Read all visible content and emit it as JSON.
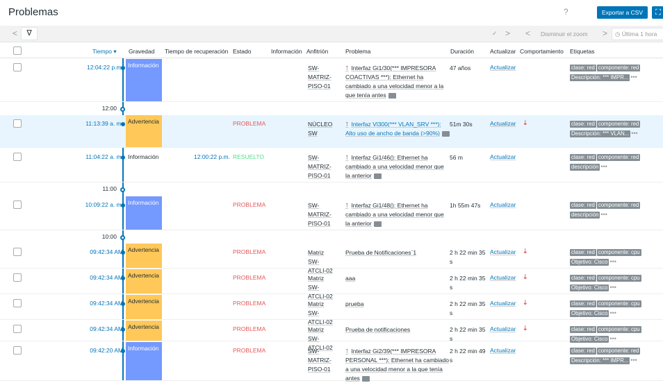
{
  "header": {
    "title": "Problemas",
    "help": "?",
    "export_label": "Exportar a CSV",
    "kiosk": "⛶"
  },
  "filterbar": {
    "prev": "<",
    "funnel": "∇",
    "chevron": "✓",
    "next": ">",
    "prev2": "<",
    "zoom_out": "Disminuir el zoom",
    "next2": ">",
    "time_range": "Última 1 hora"
  },
  "columns": {
    "time": "Tiempo ▾",
    "severity": "Gravedad",
    "recovery": "Tiempo de recuperación",
    "status": "Estado",
    "info": "Información",
    "host": "Anfitrión",
    "problem": "Problema",
    "duration": "Duración",
    "update": "Actualizar",
    "behavior": "Comportamiento",
    "tags": "Etiquetas"
  },
  "separators": [
    "12:00",
    "11:00",
    "10:00"
  ],
  "rows": [
    {
      "time": "12:04:22 p.m.",
      "severity": "Información",
      "recovery": "",
      "status": "",
      "host": "SW-MATRIZ-PISO-01",
      "problem": "Interfaz Gi1/30(*** IMPRESORA COACTIVAS ***): Ethernet ha cambiado a una velocidad menor a la que tenía antes",
      "duration": "47 años",
      "update": "Actualizar",
      "tags": [
        "clase: red",
        "componente: red",
        "Descripción: *** IMPR..."
      ]
    },
    {
      "time": "11:13:39 a. m.",
      "severity": "Advertencia",
      "recovery": "",
      "status": "PROBLEMA",
      "host": "NÚCLEO SW",
      "problem": "Interfaz Vl300(*** VLAN_SRV ***): Alto uso de ancho de banda (>90%)",
      "duration": "51m 30s",
      "update": "Actualizar",
      "tags": [
        "clase: red",
        "componente: red",
        "Descripción: *** VLAN..."
      ]
    },
    {
      "time": "11:04:22 a. m.",
      "severity": "Información",
      "recovery": "12:00:22 p.m.",
      "status": "RESUELTO",
      "host": "SW-MATRIZ-PISO-01",
      "problem": "Interfaz Gi1/46(): Ethernet ha cambiado a una velocidad menor que la anterior",
      "duration": "56 m",
      "update": "Actualizar",
      "tags": [
        "clase: red",
        "componente: red",
        "descripción"
      ]
    },
    {
      "time": "10:09:22 a. m.",
      "severity": "Información",
      "recovery": "",
      "status": "PROBLEMA",
      "host": "SW-MATRIZ-PISO-01",
      "problem": "Interfaz Gi1/48(): Ethernet ha cambiado a una velocidad menor que la anterior",
      "duration": "1h 55m 47s",
      "update": "Actualizar",
      "tags": [
        "clase: red",
        "componente: red",
        "descripción"
      ]
    },
    {
      "time": "09:42:34 AM",
      "severity": "Advertencia",
      "recovery": "",
      "status": "PROBLEMA",
      "host": "Matriz SW-ATCLI-02",
      "problem": "Prueba de Notificaciones`1",
      "duration": "2 h 22 min 35 s",
      "update": "Actualizar",
      "tags": [
        "clase: red",
        "componente: cpu",
        "Objetivo: Cisco"
      ]
    },
    {
      "time": "09:42:34 AM",
      "severity": "Advertencia",
      "recovery": "",
      "status": "PROBLEMA",
      "host": "Matriz SW-ATCLI-02",
      "problem": "aaa",
      "duration": "2 h 22 min 35 s",
      "update": "Actualizar",
      "tags": [
        "clase: red",
        "componente: cpu",
        "Objetivo: Cisco"
      ]
    },
    {
      "time": "09:42:34 AM",
      "severity": "Advertencia",
      "recovery": "",
      "status": "PROBLEMA",
      "host": "Matriz SW-ATCLI-02",
      "problem": "prueba",
      "duration": "2 h 22 min 35 s",
      "update": "Actualizar",
      "tags": [
        "clase: red",
        "componente: cpu",
        "Objetivo: Cisco"
      ]
    },
    {
      "time": "09:42:34 AM",
      "severity": "Advertencia",
      "recovery": "",
      "status": "PROBLEMA",
      "host": "Matriz SW-ATCLI-02",
      "problem": "Prueba de notificaciones",
      "duration": "2 h 22 min 35 s",
      "update": "Actualizar",
      "tags": [
        "clase: red",
        "componente: cpu",
        "Objetivo: Cisco"
      ]
    },
    {
      "time": "09:42:20 AM",
      "severity": "Información",
      "recovery": "",
      "status": "PROBLEMA",
      "host": "SW-MATRIZ-PISO-01",
      "problem": "Interfaz Gi2/39(*** IMPRESORA PERSONAL ***): Ethernet ha cambiado a una velocidad menor a la que tenía antes",
      "duration": "2 h 22 min 49 s",
      "update": "Actualizar",
      "tags": [
        "clase: red",
        "componente: red",
        "Descripción: *** IMPR..."
      ]
    }
  ],
  "colors": {
    "accent": "#0275b8",
    "info": "#7499ff",
    "warning": "#ffc859",
    "problem": "#e45959",
    "resolved": "#59db8f"
  }
}
